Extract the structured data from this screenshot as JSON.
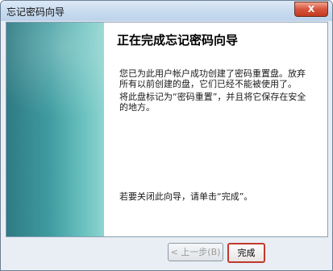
{
  "window": {
    "title": "忘记密码向导",
    "close_symbol": "X"
  },
  "content": {
    "heading": "正在完成忘记密码向导",
    "paragraph_1": "您已为此用户帐户成功创建了密码重置盘。放弃所有以前创建的盘，它们已经不能被使用了。",
    "paragraph_2": "将此盘标记为“密码重置”，并且将它保存在安全的地方。",
    "paragraph_3": "若要关闭此向导，请单击“完成”。"
  },
  "buttons": {
    "back_label": "< 上一步(B)",
    "finish_label": "完成"
  },
  "colors": {
    "side_panel": "#3f9ca0",
    "finish_highlight": "#c0392b"
  }
}
